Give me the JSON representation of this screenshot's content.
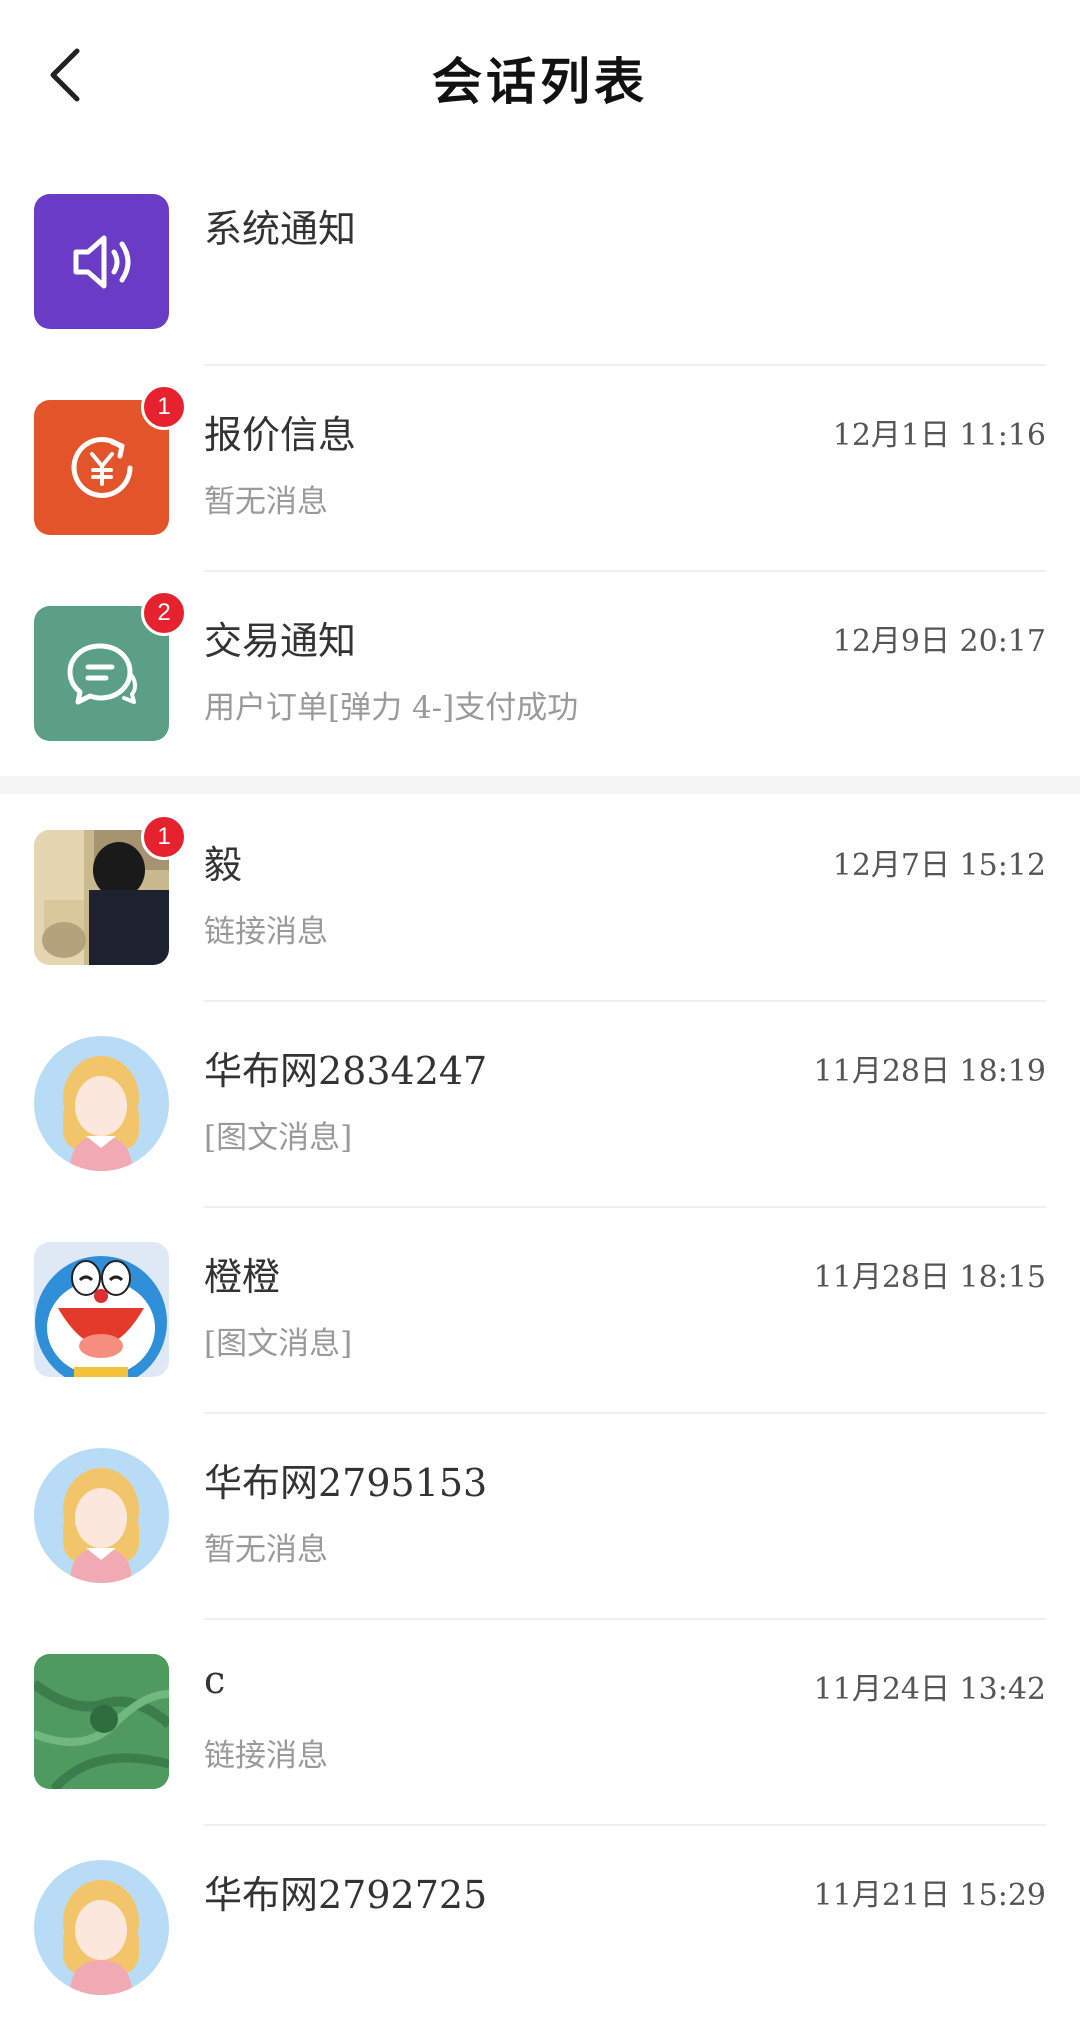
{
  "header": {
    "title": "会话列表",
    "back_icon": "chevron-left-icon"
  },
  "colors": {
    "system_avatar": "#6a3cc5",
    "quote_avatar": "#e4542a",
    "trade_avatar": "#5a9f86",
    "badge": "#e5222d",
    "preview_text": "#9a9a9a"
  },
  "conversations": [
    {
      "name": "系统通知",
      "time": "",
      "preview": "",
      "badge": "",
      "avatar": "speaker-icon"
    },
    {
      "name": "报价信息",
      "time": "12月1日 11:16",
      "preview": "暂无消息",
      "badge": "1",
      "avatar": "yen-refresh-icon"
    },
    {
      "name": "交易通知",
      "time": "12月9日 20:17",
      "preview": "用户订单[弹力 4-]支付成功",
      "badge": "2",
      "avatar": "chat-bubble-icon"
    },
    {
      "name": "毅",
      "time": "12月7日 15:12",
      "preview": "链接消息",
      "badge": "1",
      "avatar": "photo-avatar"
    },
    {
      "name": "华布网2834247",
      "time": "11月28日 18:19",
      "preview": "[图文消息]",
      "badge": "",
      "avatar": "girl-avatar"
    },
    {
      "name": "橙橙",
      "time": "11月28日 18:15",
      "preview": "[图文消息]",
      "badge": "",
      "avatar": "doraemon-avatar"
    },
    {
      "name": "华布网2795153",
      "time": "",
      "preview": "暂无消息",
      "badge": "",
      "avatar": "girl-avatar"
    },
    {
      "name": "c",
      "time": "11月24日 13:42",
      "preview": "链接消息",
      "badge": "",
      "avatar": "fabric-avatar"
    },
    {
      "name": "华布网2792725",
      "time": "11月21日 15:29",
      "preview": "",
      "badge": "",
      "avatar": "girl-avatar"
    }
  ]
}
